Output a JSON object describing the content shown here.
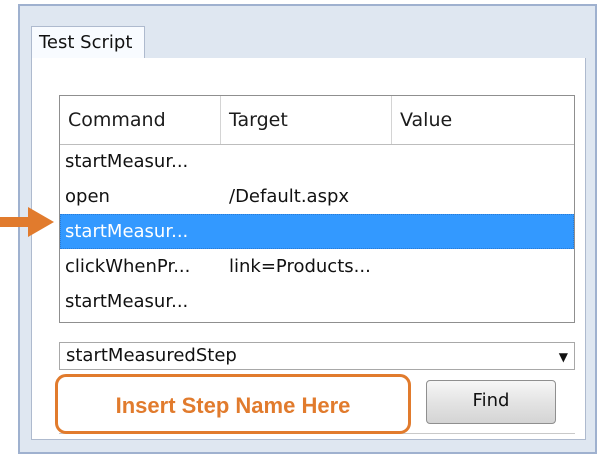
{
  "tab": {
    "label": "Test Script"
  },
  "table": {
    "headers": {
      "command": "Command",
      "target": "Target",
      "value": "Value"
    },
    "rows": [
      {
        "command": "startMeasur...",
        "target": "",
        "value": "",
        "selected": false
      },
      {
        "command": "open",
        "target": "/Default.aspx",
        "value": "",
        "selected": false
      },
      {
        "command": "startMeasur...",
        "target": "",
        "value": "",
        "selected": true
      },
      {
        "command": "clickWhenPr...",
        "target": "link=Products...",
        "value": "",
        "selected": false
      },
      {
        "command": "startMeasur...",
        "target": "",
        "value": "",
        "selected": false
      }
    ]
  },
  "command_select": {
    "value": "startMeasuredStep",
    "chevron_icon": "chevron-down-icon"
  },
  "find_button": {
    "label": "Find"
  },
  "callout": {
    "text": "Insert Step Name Here",
    "color": "#e17b2d"
  },
  "pointer": {
    "icon": "arrow-right-icon",
    "color": "#e17b2d"
  },
  "colors": {
    "selection": "#3399ff",
    "frame": "#9fb1cf"
  }
}
